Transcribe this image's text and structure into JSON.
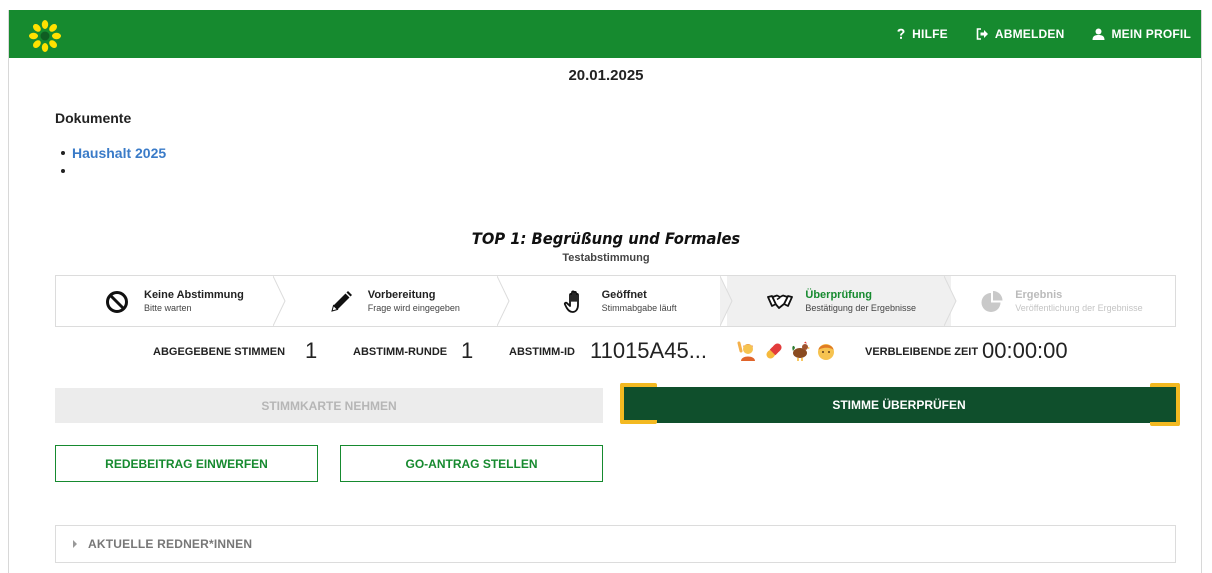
{
  "header": {
    "nav": [
      {
        "label": "HILFE",
        "icon": "help-icon"
      },
      {
        "label": "ABMELDEN",
        "icon": "logout-icon"
      },
      {
        "label": "MEIN PROFIL",
        "icon": "user-icon"
      }
    ],
    "brand_color": "#168a2f",
    "logo_icon": "sunflower-icon"
  },
  "date": "20.01.2025",
  "documents": {
    "title": "Dokumente",
    "items": [
      "Haushalt 2025",
      ""
    ]
  },
  "agenda": {
    "title": "TOP 1: Begrüßung und Formales",
    "subtitle": "Testabstimmung"
  },
  "steps": [
    {
      "title": "Keine Abstimmung",
      "desc": "Bitte warten",
      "icon": "no-entry-icon",
      "state": "done"
    },
    {
      "title": "Vorbereitung",
      "desc": "Frage wird eingegeben",
      "icon": "pencil-icon",
      "state": "done"
    },
    {
      "title": "Geöffnet",
      "desc": "Stimmabgabe läuft",
      "icon": "hand-icon",
      "state": "done"
    },
    {
      "title": "Überprüfung",
      "desc": "Bestätigung der Ergebnisse",
      "icon": "handshake-icon",
      "state": "active"
    },
    {
      "title": "Ergebnis",
      "desc": "Veröffentlichung der Ergebnisse",
      "icon": "pie-chart-icon",
      "state": "disabled"
    }
  ],
  "stats": {
    "votes_label": "ABGEGEBENE STIMMEN",
    "votes_value": "1",
    "round_label": "ABSTIMM-RUNDE",
    "round_value": "1",
    "id_label": "ABSTIMM-ID",
    "id_value": "11015A45...",
    "emojis": [
      "🙋",
      "💊",
      "🐓",
      "👦"
    ],
    "time_label": "VERBLEIBENDE ZEIT",
    "time_value": "00:00:00"
  },
  "buttons": {
    "take_ballot": "STIMMKARTE NEHMEN",
    "check_vote": "STIMME ÜBERPRÜFEN",
    "speech": "REDEBEITRAG EINWERFEN",
    "motion": "GO-ANTRAG STELLEN"
  },
  "speakers": {
    "label": "AKTUELLE REDNER*INNEN"
  },
  "colors": {
    "primary_dark": "#0f4f2c",
    "focus": "#f3b921",
    "link": "#3a7bc8"
  }
}
